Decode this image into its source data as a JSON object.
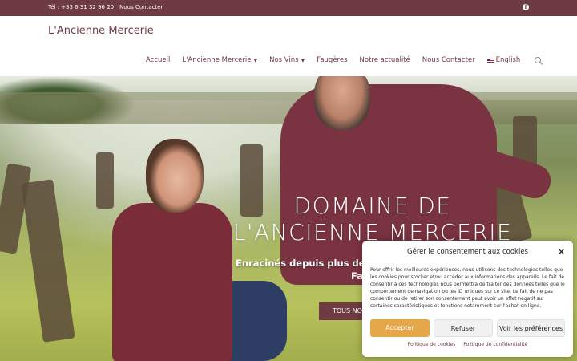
{
  "topbar": {
    "phone": "Tél : +33 6 31 32 96 20",
    "contact_link": "Nous Contacter",
    "facebook_glyph": "f"
  },
  "header": {
    "brand": "L'Ancienne Mercerie",
    "nav": [
      {
        "label": "Accueil"
      },
      {
        "label": "L'Ancienne Mercerie"
      },
      {
        "label": "Nos Vins"
      },
      {
        "label": "Faugères"
      },
      {
        "label": "Notre actualité"
      },
      {
        "label": "Nous Contacter"
      },
      {
        "label": "English"
      }
    ]
  },
  "hero": {
    "title_line1": "DOMAINE DE",
    "title_line2": "L'ANCIENNE MERCERIE",
    "subtitle_line1": "Enracinés depuis plus de",
    "subtitle_line2": "Fa",
    "cta": "TOUS NO"
  },
  "consent": {
    "title": "Gérer le consentement aux cookies",
    "close": "×",
    "body": "Pour offrir les meilleures expériences, nous utilisons des technologies telles que les cookies pour stocker et/ou accéder aux informations des appareils. Le fait de consentir à ces technologies nous permettra de traiter des données telles que le comportement de navigation ou les ID uniques sur ce site. Le fait de ne pas consentir ou de retirer son consentement peut avoir un effet négatif sur certaines caractéristiques et fonctions notamment sur l'achat en ligne.",
    "accept": "Accepter",
    "refuse": "Refuser",
    "preferences": "Voir les préférences",
    "link1": "Politique de cookies",
    "link2": "Politique de confidentialité"
  },
  "colors": {
    "brand": "#6e3b43",
    "accept": "#e6a74a"
  }
}
